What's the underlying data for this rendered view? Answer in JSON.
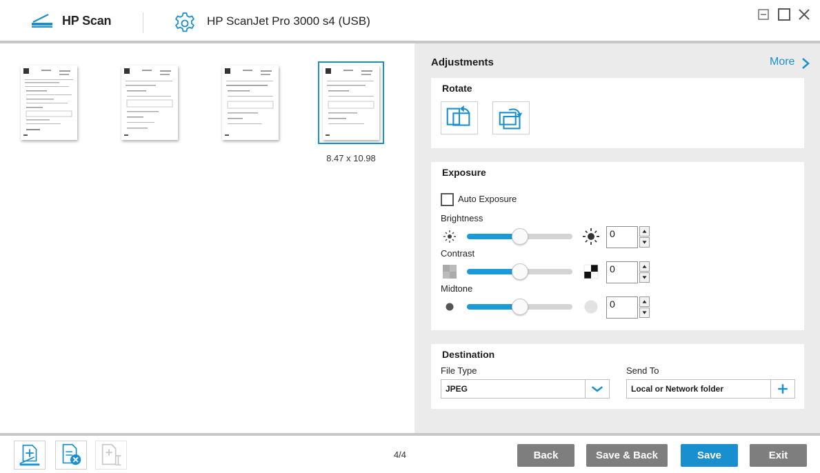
{
  "titlebar": {
    "app_name": "HP Scan",
    "device_name": "HP ScanJet Pro 3000 s4 (USB)"
  },
  "preview": {
    "selected_page_size": "8.47  x  10.98",
    "page_count": 4,
    "selected_index": 4
  },
  "adjustments": {
    "title": "Adjustments",
    "more_label": "More",
    "rotate": {
      "title": "Rotate"
    },
    "exposure": {
      "title": "Exposure",
      "auto_exposure_label": "Auto Exposure",
      "auto_exposure_checked": false,
      "brightness": {
        "label": "Brightness",
        "value": "0",
        "level": 0.5
      },
      "contrast": {
        "label": "Contrast",
        "value": "0",
        "level": 0.5
      },
      "midtone": {
        "label": "Midtone",
        "value": "0",
        "level": 0.5
      }
    },
    "destination": {
      "title": "Destination",
      "file_type_label": "File Type",
      "file_type_value": "JPEG",
      "send_to_label": "Send To",
      "send_to_value": "Local or Network folder"
    }
  },
  "footer": {
    "page_counter": "4/4",
    "back_label": "Back",
    "save_back_label": "Save & Back",
    "save_label": "Save",
    "exit_label": "Exit"
  },
  "colors": {
    "accent": "#1a8fd0",
    "button_gray": "#7e7e7e",
    "panel_bg": "#ebebeb"
  }
}
